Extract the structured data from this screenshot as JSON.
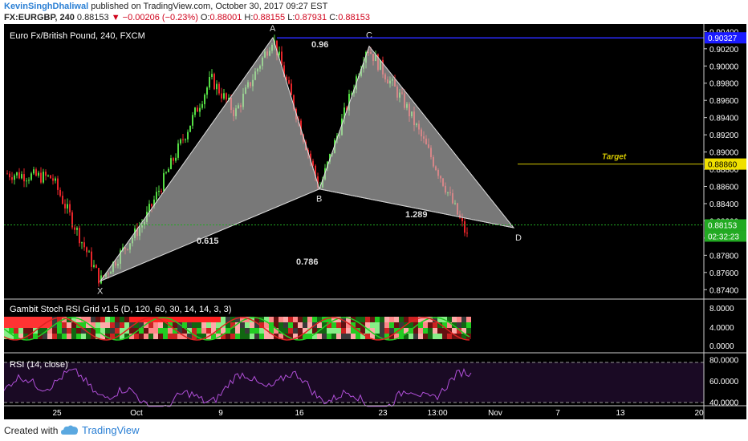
{
  "header": {
    "author": "KevinSinghDhaliwal",
    "published": "published on TradingView.com, October 30, 2017 09:27 EST",
    "symbol": "FX:EURGBP, 240",
    "last": "0.88153",
    "change": "−0.00206 (−0.23%)",
    "o_label": "O:",
    "o_value": "0.88001",
    "h_label": "H:",
    "h_value": "0.88155",
    "l_label": "L:",
    "l_value": "0.87931",
    "c_label": "C:",
    "c_value": "0.88153"
  },
  "footer": {
    "created_with": "Created with",
    "brand": "TradingView"
  },
  "colors": {
    "up": "#55dd44",
    "down": "#e8252a",
    "pattern_fill": "#c8c8c8",
    "target": "#d4c800",
    "axis_text": "#ffffff"
  },
  "chart_data": [
    {
      "type": "candlestick",
      "title": "Euro Fx/British Pound, 240, FXCM",
      "ylim": [
        0.873,
        0.9045
      ],
      "y_ticks": [
        "0.90400",
        "0.90200",
        "0.90000",
        "0.89800",
        "0.89600",
        "0.89400",
        "0.89200",
        "0.89000",
        "0.88800",
        "0.88600",
        "0.88400",
        "0.88200",
        "0.88000",
        "0.87800",
        "0.87600",
        "0.87400"
      ],
      "x_ticks": [
        "25",
        "Oct",
        "9",
        "16",
        "23",
        "13:00",
        "Nov",
        "7",
        "13",
        "20"
      ],
      "pattern_points": [
        {
          "label": "X",
          "price": 0.875
        },
        {
          "label": "A",
          "price": 0.9033
        },
        {
          "label": "B",
          "price": 0.8857
        },
        {
          "label": "C",
          "price": 0.9023
        },
        {
          "label": "D",
          "price": 0.8812
        }
      ],
      "ratios": [
        "0.615",
        "0.96",
        "1.289",
        "0.786"
      ],
      "price_tags": [
        {
          "value": "0.90327",
          "color": "#1a1aff"
        },
        {
          "value": "0.88860",
          "color": "#f0e000"
        },
        {
          "value": "0.88153",
          "color": "#22aa22"
        },
        {
          "value": "02:32:23",
          "color": "#22aa22"
        }
      ],
      "target_label": "Target",
      "target_price": 0.8886,
      "resistance_price": 0.90327,
      "last_price": 0.88153
    },
    {
      "type": "heatmap",
      "title": "Gambit Stoch RSI Grid v1.5 (D, 120, 60, 30, 14, 14, 3, 3)",
      "y_ticks": [
        "8.0000",
        "4.0000",
        "0.0000"
      ]
    },
    {
      "type": "line",
      "title": "RSI (14, close)",
      "y_ticks": [
        "80.0000",
        "60.0000",
        "40.0000"
      ],
      "ylim": [
        35,
        82
      ]
    }
  ]
}
